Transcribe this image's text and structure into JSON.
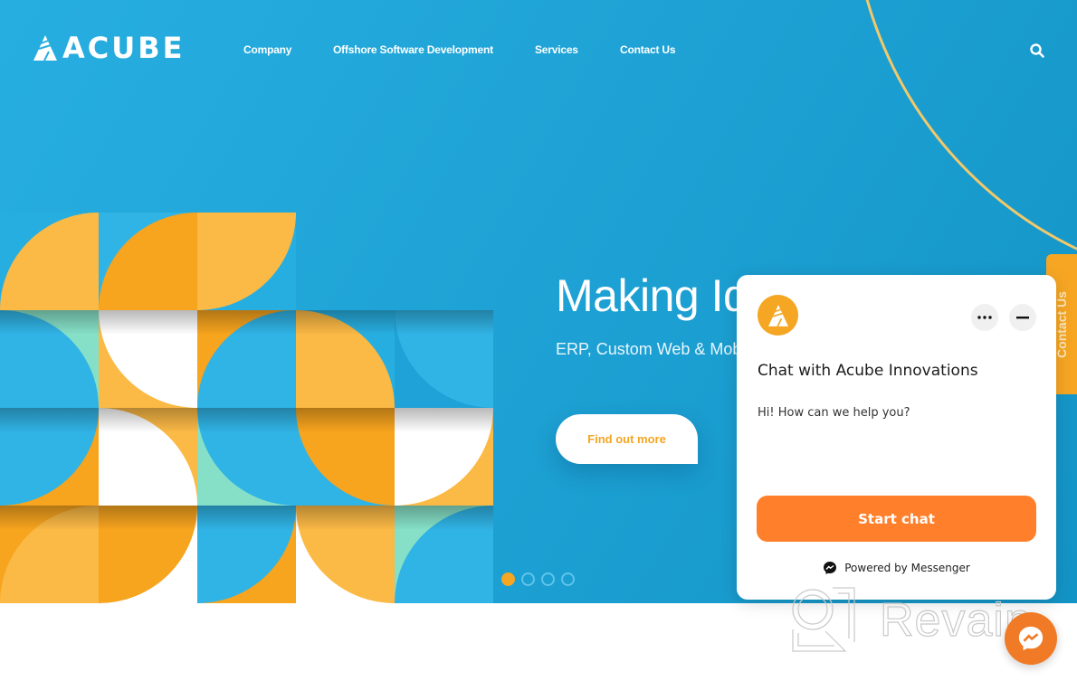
{
  "header": {
    "logo_text": "ACUBE",
    "nav": [
      {
        "label": "Company"
      },
      {
        "label": "Offshore Software Development"
      },
      {
        "label": "Services"
      },
      {
        "label": "Contact Us"
      }
    ],
    "search_icon": "search-icon"
  },
  "hero": {
    "title": "Making Ideas",
    "subtitle": "ERP, Custom Web & Mobile",
    "cta_label": "Find out more",
    "slides": {
      "count": 4,
      "active_index": 0
    }
  },
  "side_tab": {
    "label": "Contact Us"
  },
  "chat_widget": {
    "title": "Chat with Acube Innovations",
    "message": "Hi! How can we help you?",
    "start_label": "Start chat",
    "powered_by": "Powered by Messenger",
    "more_icon": "more-dots-icon",
    "minimize_icon": "minimize-icon"
  },
  "watermark": {
    "text": "Revain"
  },
  "colors": {
    "hero_blue": "#1fa3d6",
    "accent_orange": "#f5a623",
    "button_orange": "#ff7f2a",
    "arc_yellow": "#f1c96a"
  }
}
